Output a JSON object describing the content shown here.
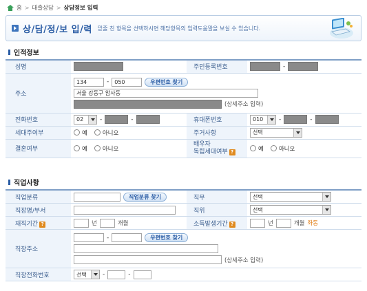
{
  "breadcrumb": {
    "items": [
      "홈",
      "대출상담",
      "상담정보 입력"
    ],
    "separator": ">"
  },
  "banner": {
    "title": "상/담/정/보 입/력",
    "description": "믿줄 친 항목을 선택하시면 해당항목의 입력도움말을 보실 수 있습니다."
  },
  "personal": {
    "section_title": "인적정보",
    "name_label": "성명",
    "ssn_label": "주민등록번호",
    "address_label": "주소",
    "zip1": "134",
    "zip2": "050",
    "zip_button": "우편번호 찾기",
    "address_line1": "서울 강동구 암사동",
    "address_detail_hint": "(상세주소 입력)",
    "phone_label": "전화번호",
    "phone_area": "02",
    "mobile_label": "휴대폰번호",
    "mobile_prefix": "010",
    "household_label": "세대주여부",
    "housing_label": "주거사항",
    "housing_value": "선택",
    "marital_label": "결혼여부",
    "spouse_label_line1": "배우자",
    "spouse_label_line2": "독립세대여부",
    "yes": "예",
    "no": "아니오"
  },
  "job": {
    "section_title": "직업사항",
    "category_label": "직업분류",
    "category_button": "직업분류 찾기",
    "duty_label": "직무",
    "duty_value": "선택",
    "company_label": "직장명/부서",
    "position_label": "직위",
    "position_value": "선택",
    "tenure_label": "재직기간",
    "income_period_label": "소득발생기간",
    "year_unit": "년",
    "month_unit": "개월",
    "change_link": "좌동",
    "work_address_label": "직장주소",
    "zip_button": "우편번호 찾기",
    "address_detail_hint": "(상세주소 입력)",
    "work_phone_label": "직장전화번호",
    "work_phone_value": "선택"
  },
  "colors": {
    "accent": "#2b5da5",
    "label_bg": "#eef4fb",
    "table_border": "#cfdceb",
    "help_icon": "#e08a1e"
  }
}
